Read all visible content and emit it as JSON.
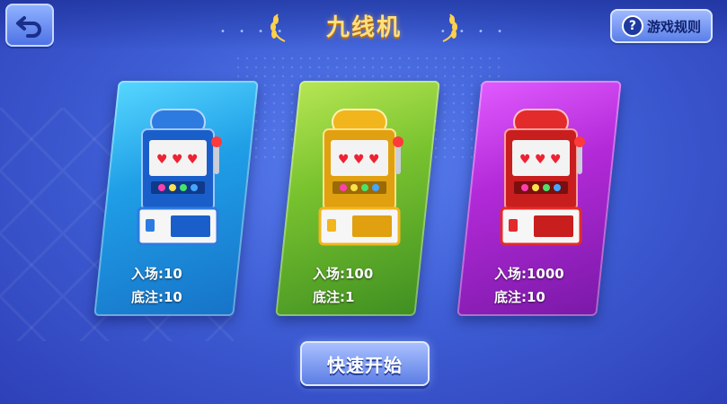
{
  "header": {
    "title": "九线机",
    "rules_label": "游戏规则",
    "back_icon": "back-arrow-icon",
    "rules_icon": "question-icon"
  },
  "rooms": [
    {
      "theme": "blue",
      "color": "#1f9ee6",
      "entry": "入场:10",
      "bet": "底注:10"
    },
    {
      "theme": "green",
      "color": "#79c32f",
      "entry": "入场:100",
      "bet": "底注:1"
    },
    {
      "theme": "purple",
      "color": "#b32ad8",
      "entry": "入场:1000",
      "bet": "底注:10"
    }
  ],
  "footer": {
    "start_label": "快速开始"
  }
}
